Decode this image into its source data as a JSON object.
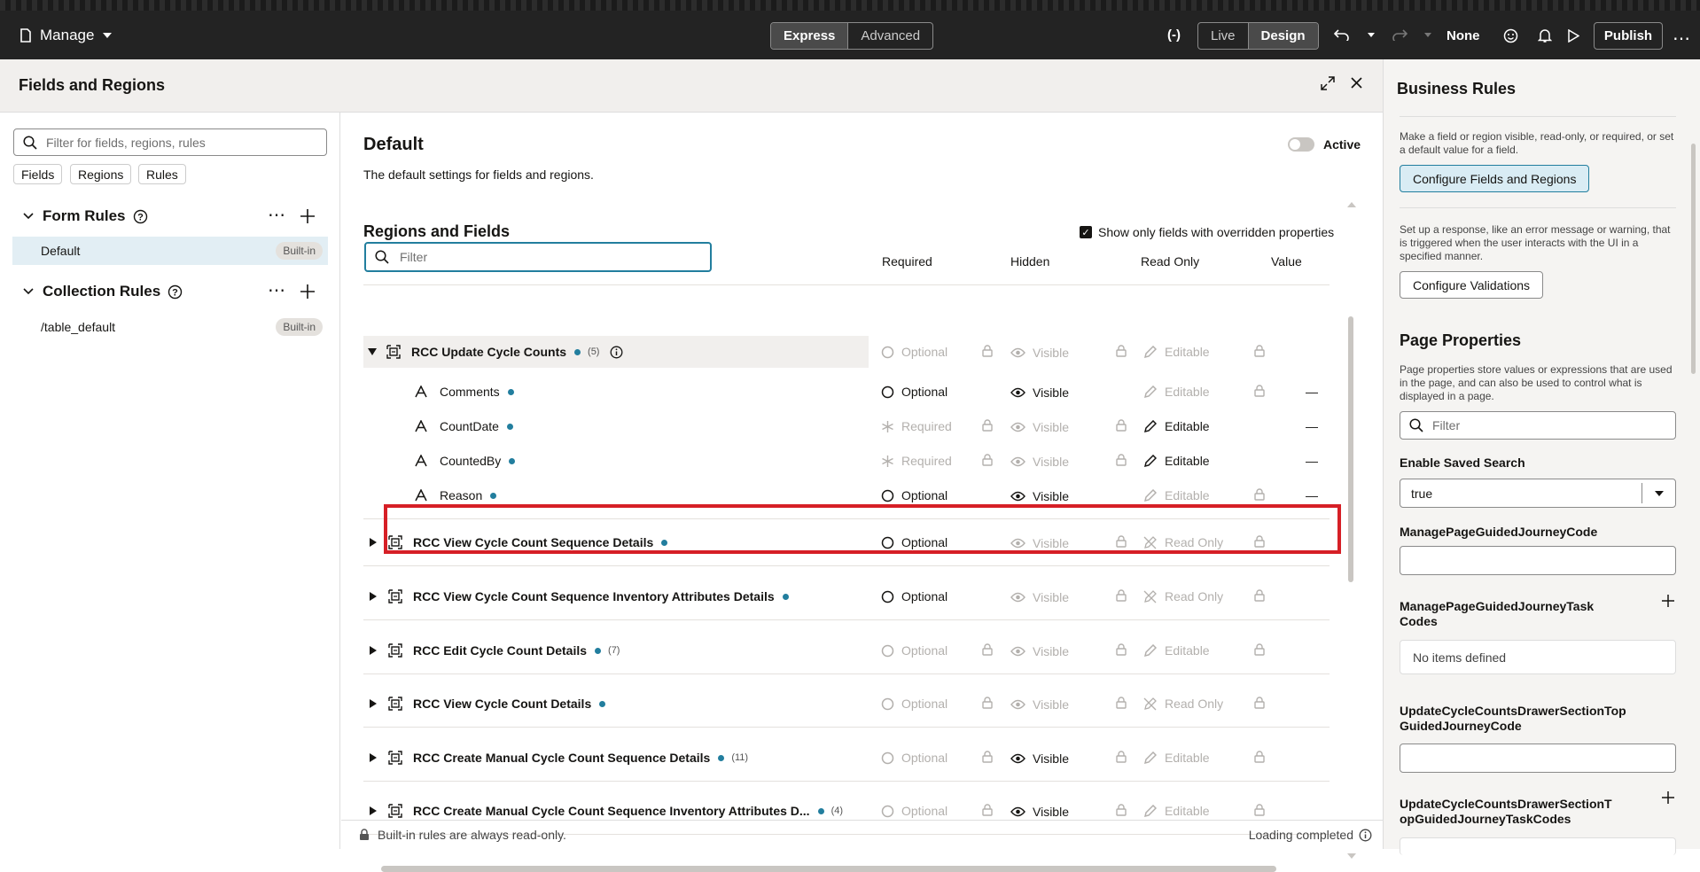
{
  "topbar": {
    "manage_label": "Manage",
    "mode_express": "Express",
    "mode_advanced": "Advanced",
    "view_live": "Live",
    "view_design": "Design",
    "none_label": "None",
    "publish_label": "Publish"
  },
  "drawer": {
    "title": "Fields and Regions",
    "left": {
      "search_placeholder": "Filter for fields, regions, rules",
      "chips": [
        "Fields",
        "Regions",
        "Rules"
      ],
      "form_rules_title": "Form Rules",
      "form_rule_item": "Default",
      "form_rule_badge": "Built-in",
      "collection_rules_title": "Collection Rules",
      "collection_rule_item": "/table_default",
      "collection_rule_badge": "Built-in"
    },
    "main": {
      "title": "Default",
      "subtitle": "The default settings for fields and regions.",
      "active_label": "Active",
      "section_title": "Regions and Fields",
      "show_only_label": "Show only fields with overridden properties",
      "filter_placeholder": "Filter",
      "col_required": "Required",
      "col_hidden": "Hidden",
      "col_readonly": "Read Only",
      "col_value": "Value",
      "rows": [
        {
          "name": "RCC Update Cycle Counts",
          "count": "(5)",
          "required": "Optional",
          "hidden": "Visible",
          "readonly": "Editable",
          "value": ""
        },
        {
          "name": "Comments",
          "required": "Optional",
          "hidden": "Visible",
          "readonly": "Editable",
          "value": "—"
        },
        {
          "name": "CountDate",
          "required": "Required",
          "hidden": "Visible",
          "readonly": "Editable",
          "value": "—"
        },
        {
          "name": "CountedBy",
          "required": "Required",
          "hidden": "Visible",
          "readonly": "Editable",
          "value": "—"
        },
        {
          "name": "Reason",
          "required": "Optional",
          "hidden": "Visible",
          "readonly": "Editable",
          "value": "—"
        },
        {
          "name": "RCC View Cycle Count Sequence Details",
          "required": "Optional",
          "hidden": "Visible",
          "readonly": "Read Only"
        },
        {
          "name": "RCC View Cycle Count Sequence Inventory Attributes Details",
          "required": "Optional",
          "hidden": "Visible",
          "readonly": "Read Only"
        },
        {
          "name": "RCC Edit Cycle Count Details",
          "count": "(7)",
          "required": "Optional",
          "hidden": "Visible",
          "readonly": "Editable"
        },
        {
          "name": "RCC View Cycle Count Details",
          "required": "Optional",
          "hidden": "Visible",
          "readonly": "Read Only"
        },
        {
          "name": "RCC Create Manual Cycle Count Sequence Details",
          "count": "(11)",
          "required": "Optional",
          "hidden": "Visible",
          "readonly": "Editable"
        },
        {
          "name": "RCC Create Manual Cycle Count Sequence Inventory Attributes D...",
          "count": "(4)",
          "required": "Optional",
          "hidden": "Visible",
          "readonly": "Editable"
        }
      ],
      "footer_left": "Built-in rules are always read-only.",
      "footer_right": "Loading completed"
    }
  },
  "business_rules": {
    "title": "Business Rules",
    "desc1": "Make a field or region visible, read-only, or required, or set a default value for a field.",
    "btn_fields": "Configure Fields and Regions",
    "desc2": "Set up a response, like an error message or warning, that is triggered when the user interacts with the UI in a specified manner.",
    "btn_validations": "Configure Validations",
    "page_props_title": "Page Properties",
    "page_props_desc": "Page properties store values or expressions that are used in the page, and can also be used to control what is displayed in a page.",
    "filter_placeholder": "Filter",
    "saved_search_label": "Enable Saved Search",
    "saved_search_value": "true",
    "guided_code_label": "ManagePageGuidedJourneyCode",
    "guided_task_label": "ManagePageGuidedJourneyTask Codes",
    "no_items": "No items defined",
    "drawer_top_code_label": "UpdateCycleCountsDrawerSectionTop GuidedJourneyCode",
    "drawer_top_task_label": "UpdateCycleCountsDrawerSectionT opGuidedJourneyTaskCodes"
  },
  "colors": {
    "accent": "#227e9e",
    "highlight": "#d61f26",
    "topbar": "#232323"
  }
}
